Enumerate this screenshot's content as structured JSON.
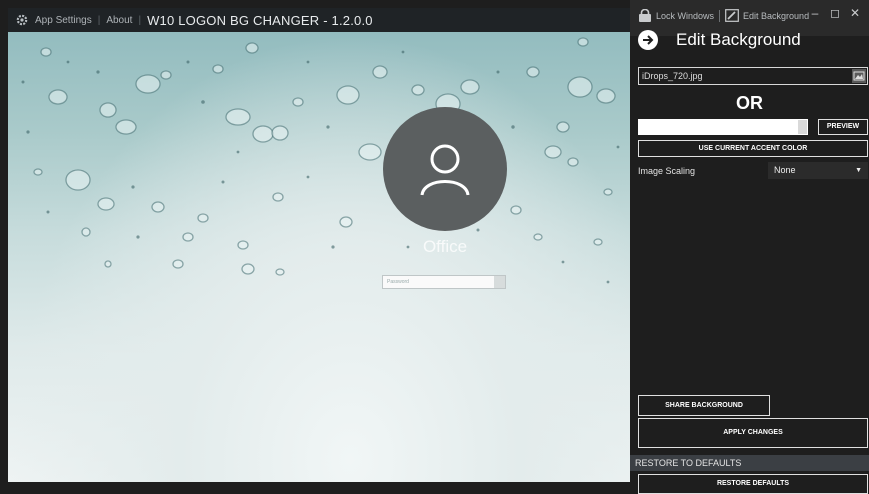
{
  "titlebar": {
    "app_settings": "App Settings",
    "about": "About",
    "separator": "|",
    "app_title": "W10 LOGON BG CHANGER - 1.2.0.0"
  },
  "login_preview": {
    "user_name": "Office",
    "password_placeholder": "Password"
  },
  "panel_top": {
    "lock_windows": "Lock Windows",
    "edit_background": "Edit Background",
    "minimize": "–",
    "maximize": "◻",
    "close": "✕"
  },
  "edit": {
    "title": "Edit Background",
    "file_value": "iDrops_720.jpg",
    "or_label": "OR",
    "color_value": "",
    "preview_btn": "PREVIEW",
    "accent_btn": "USE CURRENT ACCENT COLOR",
    "scaling_label": "Image Scaling",
    "scaling_value": "None",
    "share_btn": "SHARE BACKGROUND",
    "apply_btn": "APPLY CHANGES"
  },
  "restore": {
    "section_label": "RESTORE TO DEFAULTS",
    "button": "RESTORE DEFAULTS"
  },
  "icons": [
    "gear-icon",
    "lock-icon",
    "edit-icon",
    "arrow-right-icon",
    "image-browse-icon",
    "user-icon",
    "chevron-down-icon"
  ]
}
